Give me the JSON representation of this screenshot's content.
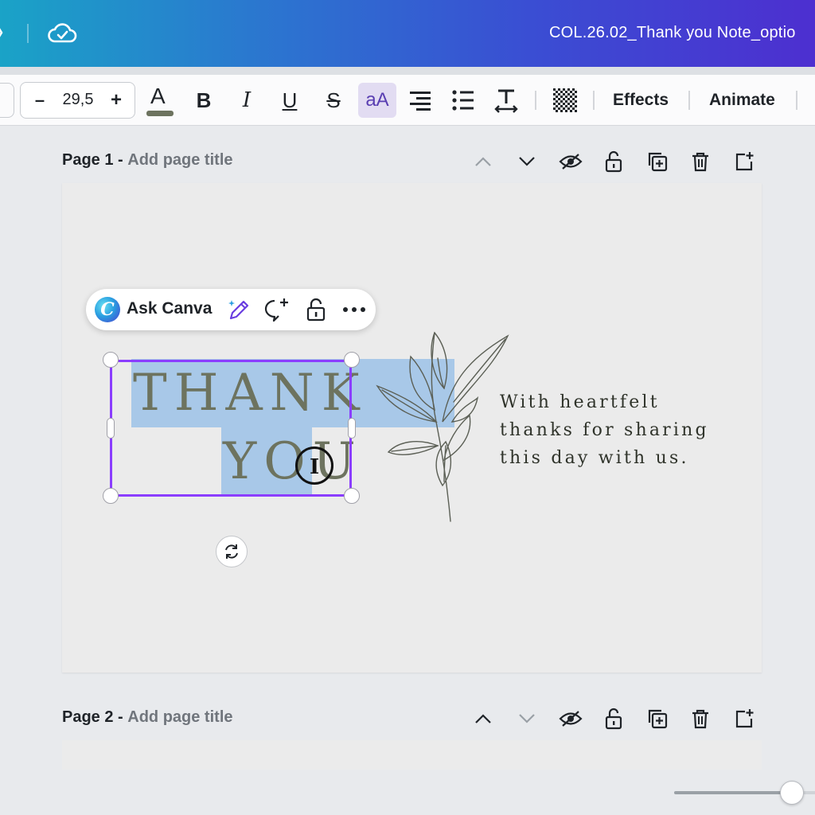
{
  "header": {
    "doc_title": "COL.26.02_Thank you Note_optio"
  },
  "toolbar": {
    "font_size": "29,5",
    "minus": "–",
    "plus": "+",
    "text_color_glyph": "A",
    "bold_glyph": "B",
    "italic_glyph": "I",
    "underline_glyph": "U",
    "strike_glyph": "S",
    "case_glyph": "aA",
    "effects_label": "Effects",
    "animate_label": "Animate"
  },
  "page1": {
    "number_label": "Page 1 -",
    "title_placeholder": "Add page title"
  },
  "page2": {
    "number_label": "Page 2 -",
    "title_placeholder": "Add page title"
  },
  "context_menu": {
    "logo_glyph": "C",
    "ask_label": "Ask Canva"
  },
  "design": {
    "thank_text": "THANK",
    "you_text": "YOU",
    "message_line1": "With heartfelt",
    "message_line2": "thanks for sharing",
    "message_line3": "this day with us."
  },
  "colors": {
    "selection": "#8b3dff",
    "highlight": "#a8c8e8",
    "title_text": "#6d735f"
  }
}
